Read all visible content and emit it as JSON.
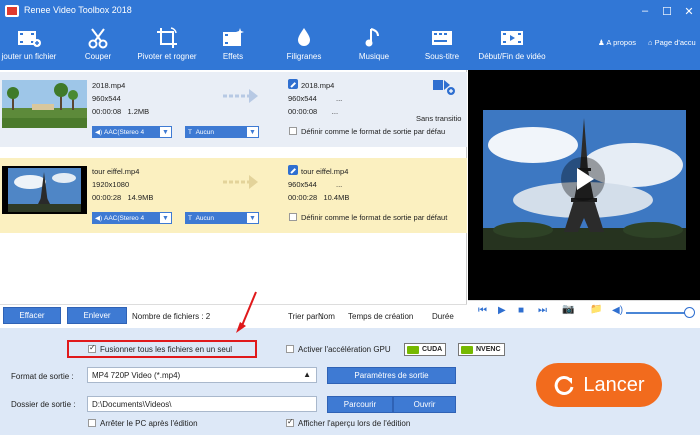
{
  "app": {
    "title": "Renee Video Toolbox 2018",
    "window_controls": [
      "–",
      "☐",
      "✕"
    ]
  },
  "toolbar": {
    "items": [
      {
        "label": "jouter un fichier",
        "icon": "film-add-icon"
      },
      {
        "label": "Couper",
        "icon": "scissors-icon"
      },
      {
        "label": "Pivoter et rogner",
        "icon": "crop-rotate-icon"
      },
      {
        "label": "Effets",
        "icon": "effects-film-icon"
      },
      {
        "label": "Filigranes",
        "icon": "watermark-drops-icon"
      },
      {
        "label": "Musique",
        "icon": "music-note-icon"
      },
      {
        "label": "Sous-titre",
        "icon": "subtitle-icon"
      },
      {
        "label": "Début/Fin de vidéo",
        "icon": "video-intro-icon"
      }
    ],
    "about": "A propos",
    "homepage": "Page d'accu"
  },
  "files": [
    {
      "source_name": "2018.mp4",
      "source_res": "960x544",
      "source_duration": "00:00:08",
      "source_size": "1.2MB",
      "output_name": "2018.mp4",
      "output_res": "960x544",
      "output_ellipsis1": "...",
      "output_duration": "00:00:08",
      "output_ellipsis2": "...",
      "transition": "Sans transitio",
      "audio": "AAC(Stereo 4",
      "subtitle": "Aucun",
      "default_format": "Définir comme le format de sortie par défau"
    },
    {
      "source_name": "tour eiffel.mp4",
      "source_res": "1920x1080",
      "source_duration": "00:00:28",
      "source_size": "14.9MB",
      "output_name": "tour eiffel.mp4",
      "output_res": "960x544",
      "output_ellipsis1": "...",
      "output_duration": "00:00:28",
      "output_size": "10.4MB",
      "audio": "AAC(Stereo 4",
      "subtitle": "Aucun",
      "default_format": "Définir comme le format de sortie par défaut"
    }
  ],
  "actions": {
    "clear": "Effacer",
    "remove": "Enlever",
    "file_count": "Nombre de fichiers : 2",
    "sort_by": "Trier par :",
    "sort_name": "Nom",
    "sort_created": "Temps de création",
    "sort_duration": "Durée"
  },
  "bottom": {
    "merge_label": "Fusionner tous les fichiers en un seul",
    "merge_checked": true,
    "gpu_label": "Activer l'accélération GPU",
    "gpu_checked": false,
    "cuda": "CUDA",
    "nvenc": "NVENC",
    "output_format_label": "Format de sortie :",
    "output_format_value": "MP4 720P Video (*.mp4)",
    "output_settings": "Paramètres de sortie",
    "output_folder_label": "Dossier de sortie :",
    "output_folder_value": "D:\\Documents\\Videos\\",
    "browse": "Parcourir",
    "open": "Ouvrir",
    "shutdown_label": "Arrêter le PC après l'édition",
    "shutdown_checked": false,
    "preview_label": "Afficher l'aperçu lors de l'édition",
    "preview_checked": true,
    "launch": "Lancer"
  },
  "colors": {
    "header_blue": "#3177d6",
    "button_blue": "#3e7ad3",
    "selected_row": "#fbf0c0",
    "launch_orange": "#f26b1d",
    "highlight_red": "#e0191b",
    "bottom_panel": "#dde8f7"
  }
}
